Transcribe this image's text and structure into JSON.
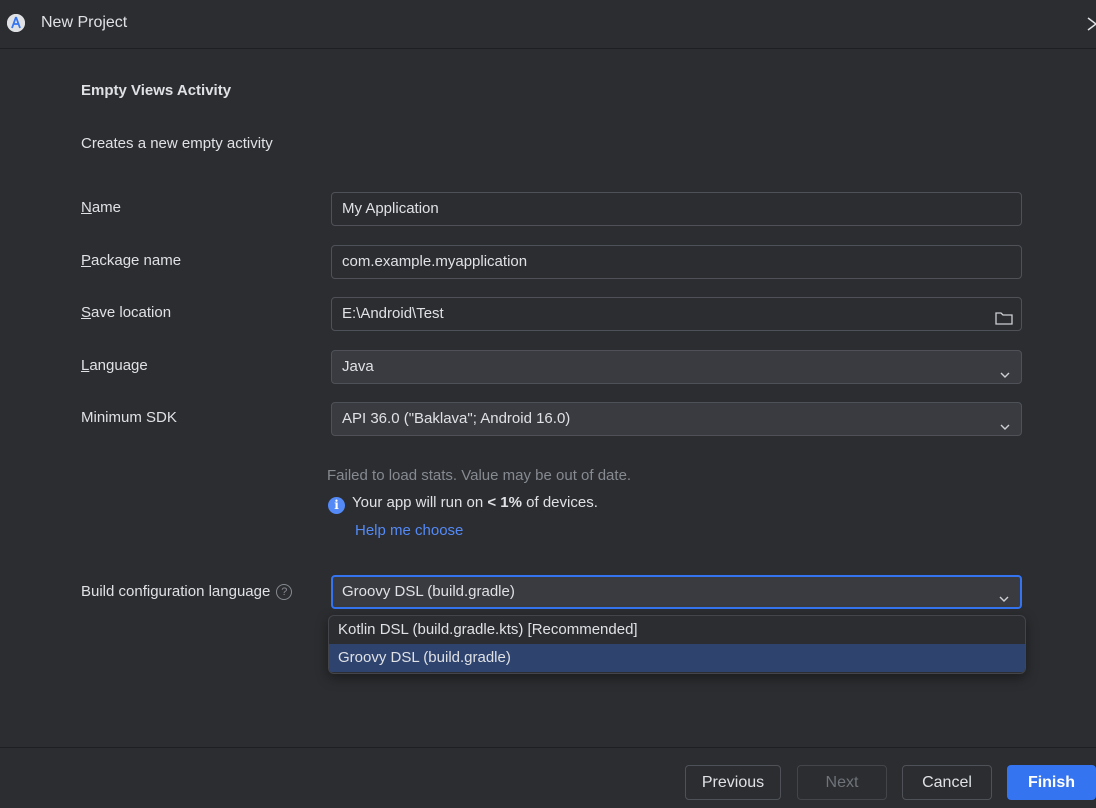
{
  "window": {
    "title": "New Project",
    "icon": "android-studio-icon"
  },
  "header": {
    "template_name": "Empty Views Activity",
    "template_description": "Creates a new empty activity"
  },
  "form": {
    "name": {
      "label_prefix": "N",
      "label_rest": "ame",
      "value": "My Application"
    },
    "package": {
      "label_prefix": "P",
      "label_rest": "ackage name",
      "value": "com.example.myapplication"
    },
    "save_location": {
      "label_prefix": "S",
      "label_rest": "ave location",
      "value": "E:\\Android\\Test"
    },
    "language": {
      "label_prefix": "L",
      "label_rest": "anguage",
      "value": "Java"
    },
    "min_sdk": {
      "label": "Minimum SDK",
      "value": "API 36.0 (\"Baklava\"; Android 16.0)"
    },
    "stats_warning": "Failed to load stats. Value may be out of date.",
    "info_prefix": "Your app will run on ",
    "info_bold": "< 1%",
    "info_suffix": " of devices.",
    "help_link": "Help me choose",
    "build_config": {
      "label": "Build configuration language",
      "value": "Groovy DSL (build.gradle)",
      "options": [
        "Kotlin DSL (build.gradle.kts) [Recommended]",
        "Groovy DSL (build.gradle)"
      ]
    }
  },
  "footer": {
    "previous": "Previous",
    "next": "Next",
    "cancel": "Cancel",
    "finish": "Finish"
  },
  "colors": {
    "background": "#2b2d30",
    "accent": "#3574f0",
    "link": "#548af7",
    "selected_row": "#2e436e"
  }
}
